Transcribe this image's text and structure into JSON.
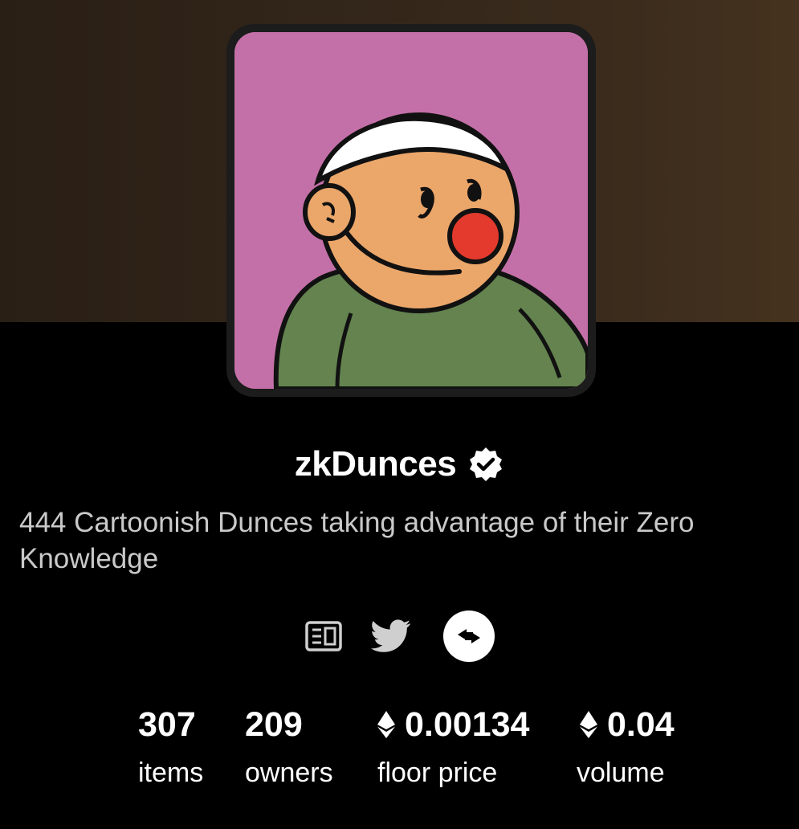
{
  "collection": {
    "name": "zkDunces",
    "verified": true,
    "description": "444 Cartoonish Dunces taking advantage of their Zero Knowledge"
  },
  "socials": [
    {
      "icon": "website-icon"
    },
    {
      "icon": "twitter-icon"
    },
    {
      "icon": "bridge-icon"
    }
  ],
  "stats": {
    "items": {
      "value": "307",
      "label": "items"
    },
    "owners": {
      "value": "209",
      "label": "owners"
    },
    "floor_price": {
      "value": "0.00134",
      "label": "floor price",
      "currency_icon": "eth-icon"
    },
    "volume": {
      "value": "0.04",
      "label": "volume",
      "currency_icon": "eth-icon"
    }
  },
  "colors": {
    "background": "#000000",
    "banner": "#33261a",
    "avatar_bg": "#c470a8",
    "description_text": "#c9c9c9"
  }
}
